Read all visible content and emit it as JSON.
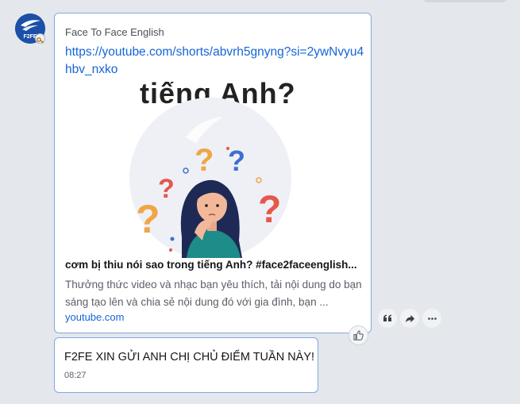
{
  "avatar": {
    "label": "F2FE"
  },
  "link_message": {
    "sender": "Face To Face English",
    "url": "https://youtube.com/shorts/abvrh5gnyng?si=2ywNvyu4hbv_nxko",
    "preview": {
      "thumbnail_heading": "tiếng Anh?",
      "title": "cơm bị thiu nói sao trong tiếng Anh? #face2faceenglish...",
      "description": "Thưởng thức video và nhạc bạn yêu thích, tải nội dung do bạn sáng tạo lên và chia sẻ nội dung đó với gia đình, bạn ...",
      "domain": "youtube.com"
    }
  },
  "actions": {
    "quote_icon": "quote-icon",
    "forward_icon": "forward-icon",
    "more_icon": "more-icon",
    "like_icon": "thumbs-up-icon"
  },
  "text_message": {
    "text": "F2FE XIN GỬI ANH CHỊ CHỦ ĐIỂM TUẦN NÀY!",
    "time": "08:27"
  },
  "colors": {
    "background": "#e4e7ec",
    "bubble_border": "#84a7e3",
    "link": "#1565d6"
  }
}
